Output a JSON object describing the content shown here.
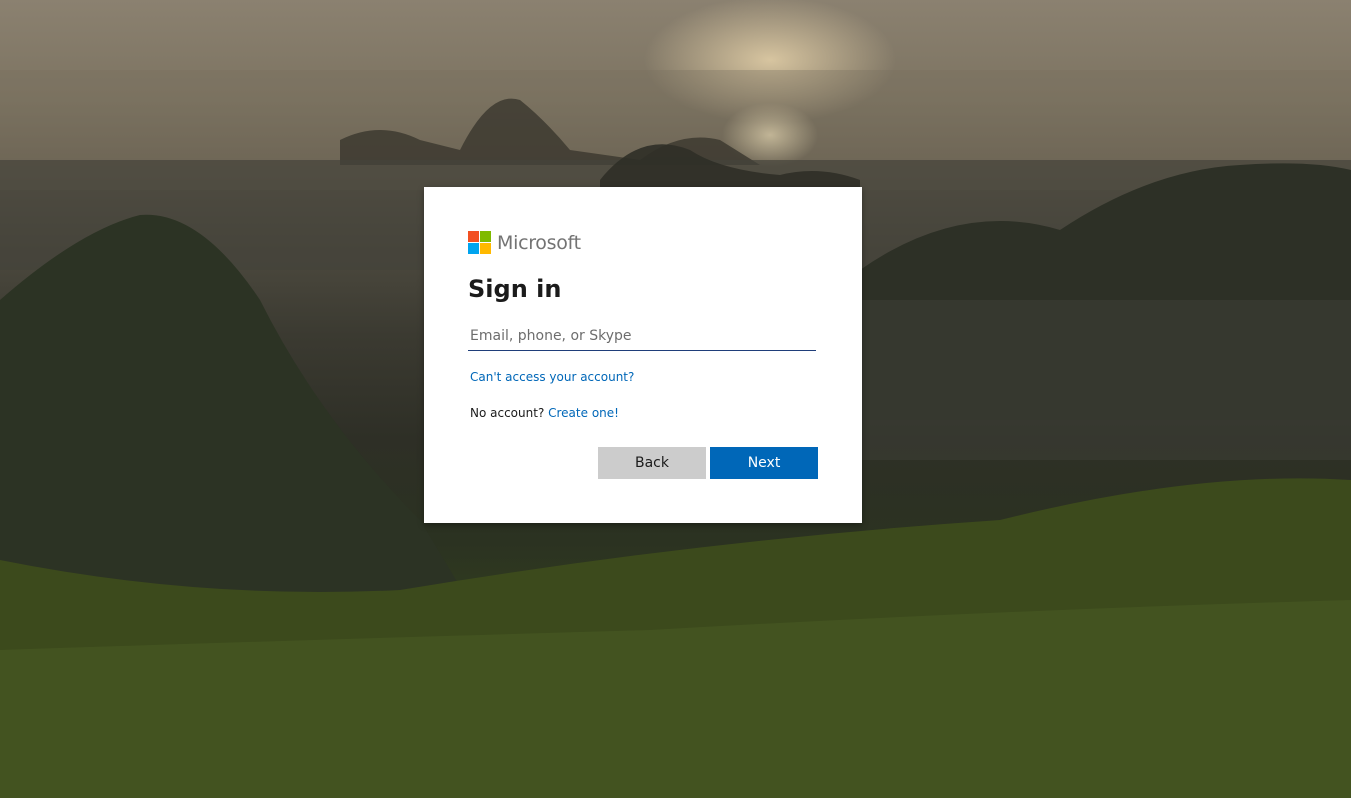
{
  "brand": {
    "name": "Microsoft",
    "logo_colors": [
      "#f25022",
      "#7fba00",
      "#00a4ef",
      "#ffb900"
    ]
  },
  "signin": {
    "title": "Sign in",
    "input_placeholder": "Email, phone, or Skype",
    "input_value": "",
    "cant_access_link": "Can't access your account?",
    "no_account_text": "No account?",
    "create_link": "Create one!",
    "back_label": "Back",
    "next_label": "Next"
  },
  "colors": {
    "accent": "#0067b8",
    "back_button": "#cccccc"
  }
}
